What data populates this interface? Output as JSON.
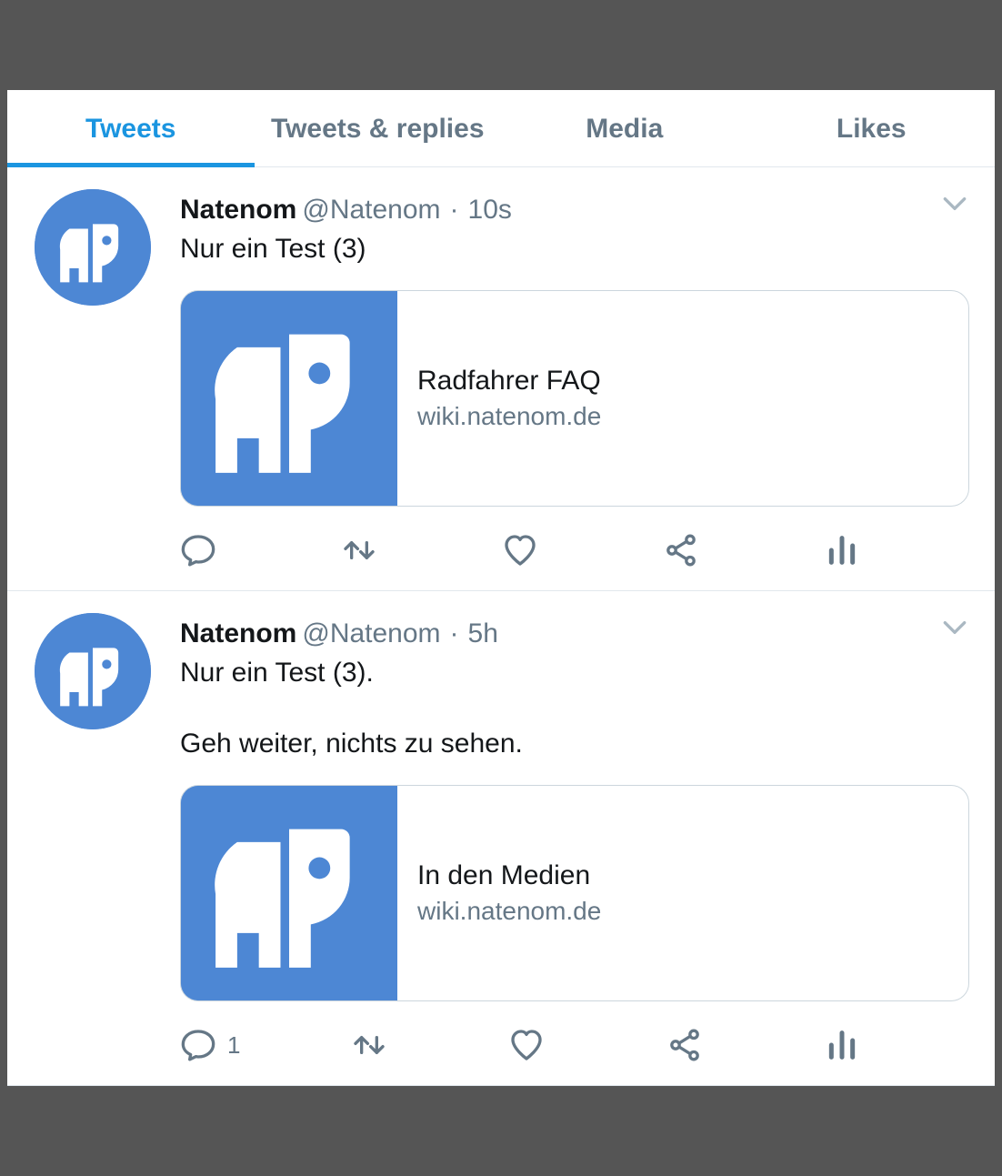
{
  "tabs": [
    {
      "label": "Tweets",
      "active": true
    },
    {
      "label": "Tweets & replies",
      "active": false
    },
    {
      "label": "Media",
      "active": false
    },
    {
      "label": "Likes",
      "active": false
    }
  ],
  "tweets": [
    {
      "author_name": "Natenom",
      "author_handle": "@Natenom",
      "time": "10s",
      "text": "Nur ein Test (3)",
      "card": {
        "title": "Radfahrer FAQ",
        "domain": "wiki.natenom.de"
      },
      "counts": {
        "reply": "",
        "retweet": "",
        "like": "",
        "share": "",
        "analytics": ""
      }
    },
    {
      "author_name": "Natenom",
      "author_handle": "@Natenom",
      "time": "5h",
      "text": "Nur ein Test (3).\n\nGeh weiter, nichts zu sehen.",
      "card": {
        "title": "In den Medien",
        "domain": "wiki.natenom.de"
      },
      "counts": {
        "reply": "1",
        "retweet": "",
        "like": "",
        "share": "",
        "analytics": ""
      }
    }
  ]
}
